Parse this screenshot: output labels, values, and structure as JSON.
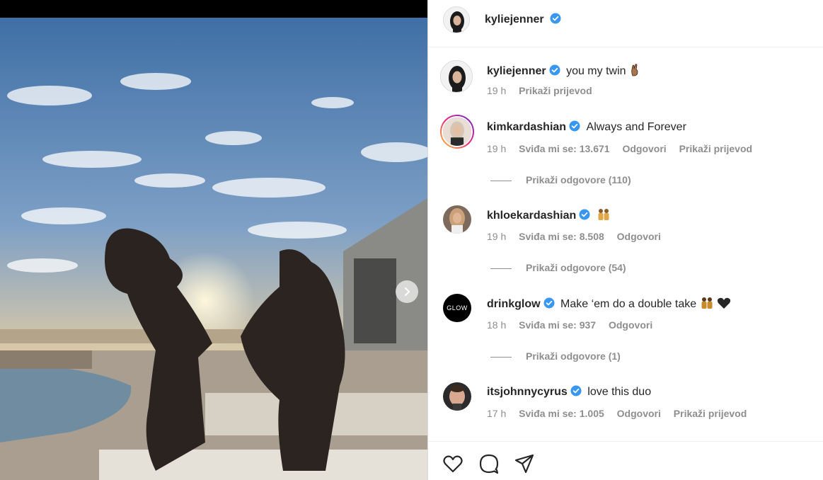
{
  "post": {
    "author": "kyliejenner"
  },
  "caption": {
    "user": "kyliejenner",
    "text": "you my twin",
    "time": "19 h",
    "translate": "Prikaži prijevod"
  },
  "comments": [
    {
      "user": "kimkardashian",
      "text": "Always and Forever",
      "time": "19 h",
      "likes": "Sviđa mi se: 13.671",
      "reply": "Odgovori",
      "translate": "Prikaži prijevod",
      "view_replies": "Prikaži odgovore (110)"
    },
    {
      "user": "khloekardashian",
      "text": "",
      "time": "19 h",
      "likes": "Sviđa mi se: 8.508",
      "reply": "Odgovori",
      "view_replies": "Prikaži odgovore (54)"
    },
    {
      "user": "drinkglow",
      "text": "Make ‘em do a double take",
      "time": "18 h",
      "likes": "Sviđa mi se: 937",
      "reply": "Odgovori",
      "view_replies": "Prikaži odgovore (1)"
    },
    {
      "user": "itsjohnnycyrus",
      "text": "love this duo",
      "time": "17 h",
      "likes": "Sviđa mi se: 1.005",
      "reply": "Odgovori",
      "translate": "Prikaži prijevod"
    }
  ],
  "drinkglow_logo": "GLOW",
  "icons": {
    "verified": "verified-badge-icon",
    "like": "heart-icon",
    "comment": "comment-bubble-icon",
    "share": "paper-plane-icon",
    "next": "chevron-right-icon"
  },
  "colors": {
    "verified": "#3897f0",
    "muted": "#8e8e8e",
    "text": "#262626"
  }
}
